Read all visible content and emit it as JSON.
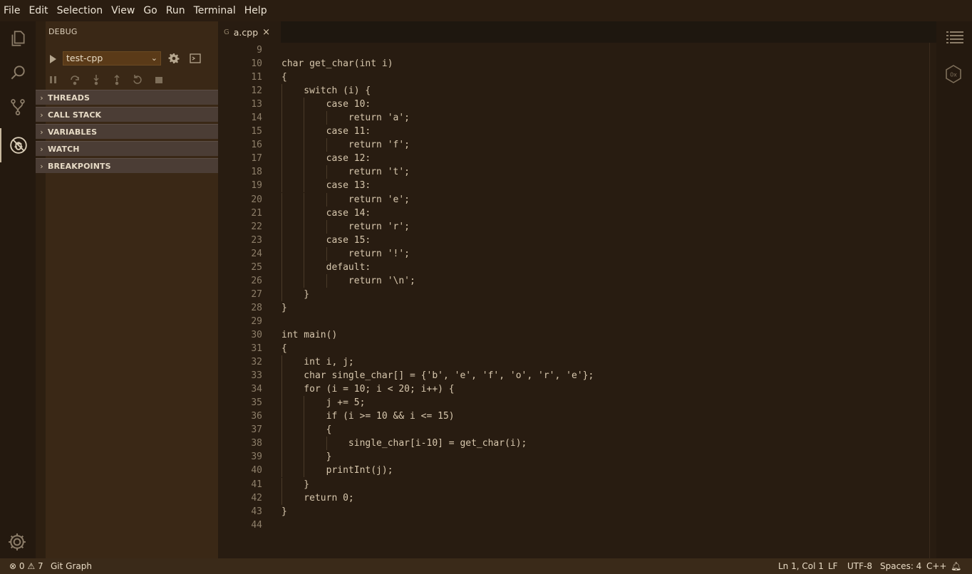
{
  "menu": [
    "File",
    "Edit",
    "Selection",
    "View",
    "Go",
    "Run",
    "Terminal",
    "Help"
  ],
  "sidebar": {
    "title": "DEBUG",
    "config": "test-cpp",
    "sections": [
      "THREADS",
      "CALL STACK",
      "VARIABLES",
      "WATCH",
      "BREAKPOINTS"
    ]
  },
  "tab": {
    "label": "a.cpp",
    "close": "×",
    "icon": "G"
  },
  "editor": {
    "lines": [
      {
        "n": "9",
        "t": ""
      },
      {
        "n": "10",
        "t": "char get_char(int i)"
      },
      {
        "n": "11",
        "t": "{"
      },
      {
        "n": "12",
        "t": "    switch (i) {"
      },
      {
        "n": "13",
        "t": "        case 10:"
      },
      {
        "n": "14",
        "t": "            return 'a';"
      },
      {
        "n": "15",
        "t": "        case 11:"
      },
      {
        "n": "16",
        "t": "            return 'f';"
      },
      {
        "n": "17",
        "t": "        case 12:"
      },
      {
        "n": "18",
        "t": "            return 't';"
      },
      {
        "n": "19",
        "t": "        case 13:"
      },
      {
        "n": "20",
        "t": "            return 'e';"
      },
      {
        "n": "21",
        "t": "        case 14:"
      },
      {
        "n": "22",
        "t": "            return 'r';"
      },
      {
        "n": "23",
        "t": "        case 15:"
      },
      {
        "n": "24",
        "t": "            return '!';"
      },
      {
        "n": "25",
        "t": "        default:"
      },
      {
        "n": "26",
        "t": "            return '\\n';"
      },
      {
        "n": "27",
        "t": "    }"
      },
      {
        "n": "28",
        "t": "}"
      },
      {
        "n": "29",
        "t": ""
      },
      {
        "n": "30",
        "t": "int main()"
      },
      {
        "n": "31",
        "t": "{"
      },
      {
        "n": "32",
        "t": "    int i, j;"
      },
      {
        "n": "33",
        "t": "    char single_char[] = {'b', 'e', 'f', 'o', 'r', 'e'};"
      },
      {
        "n": "34",
        "t": "    for (i = 10; i < 20; i++) {"
      },
      {
        "n": "35",
        "t": "        j += 5;"
      },
      {
        "n": "36",
        "t": "        if (i >= 10 && i <= 15)"
      },
      {
        "n": "37",
        "t": "        {"
      },
      {
        "n": "38",
        "t": "            single_char[i-10] = get_char(i);"
      },
      {
        "n": "39",
        "t": "        }"
      },
      {
        "n": "40",
        "t": "        printInt(j);"
      },
      {
        "n": "41",
        "t": "    }"
      },
      {
        "n": "42",
        "t": "    return 0;"
      },
      {
        "n": "43",
        "t": "}"
      },
      {
        "n": "44",
        "t": ""
      }
    ]
  },
  "status": {
    "errors": "0",
    "warnings": "7",
    "git_graph": "Git Graph",
    "position": "Ln 1, Col 1",
    "eol": "LF",
    "encoding": "UTF-8",
    "spaces": "Spaces: 4",
    "language": "C++"
  },
  "icons": {
    "activity": [
      "files-icon",
      "search-icon",
      "source-control-icon",
      "debug-icon",
      "settings-gear-icon"
    ],
    "right": [
      "outline-icon",
      "hex-editor-icon"
    ],
    "status": [
      "error-icon",
      "warning-icon",
      "bell-icon"
    ]
  },
  "colors": {
    "background": "#281c11",
    "sidebar": "#3a2816",
    "section": "#4b3d35",
    "statusbar": "#3a2a19"
  }
}
